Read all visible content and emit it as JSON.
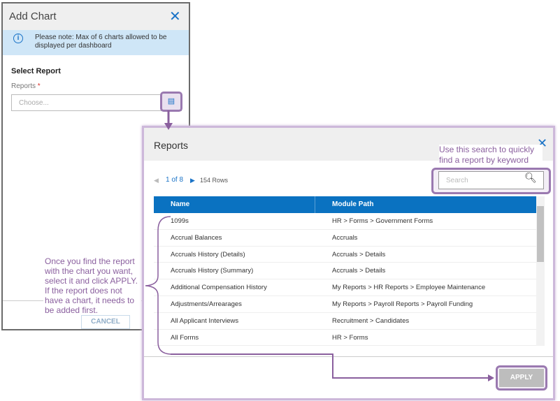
{
  "add_chart": {
    "title": "Add Chart",
    "banner": "Please note: Max of 6 charts allowed to be displayed per dashboard",
    "section": "Select Report",
    "reports_label": "Reports",
    "required": "*",
    "placeholder": "Choose...",
    "cancel": "CANCEL"
  },
  "callouts": {
    "search": "Use this search to quickly find a report by keyword",
    "select": "Once you find the report with the chart you want, select it and click APPLY. If the report does not have a chart, it needs to be added first."
  },
  "reports": {
    "title": "Reports",
    "page": "1 of 8",
    "rows": "154 Rows",
    "search_placeholder": "Search",
    "columns": [
      "Name",
      "Module Path"
    ],
    "items": [
      [
        "1099s",
        "HR > Forms > Government Forms"
      ],
      [
        "Accrual Balances",
        "Accruals"
      ],
      [
        "Accruals History (Details)",
        "Accruals > Details"
      ],
      [
        "Accruals History (Summary)",
        "Accruals > Details"
      ],
      [
        "Additional Compensation History",
        "My Reports > HR Reports > Employee Maintenance"
      ],
      [
        "Adjustments/Arrearages",
        "My Reports > Payroll Reports > Payroll Funding"
      ],
      [
        "All Applicant Interviews",
        "Recruitment > Candidates"
      ],
      [
        "All Forms",
        "HR > Forms"
      ]
    ],
    "apply": "APPLY"
  },
  "colors": {
    "accent": "#0a72c1",
    "callout": "#8a5f9e"
  }
}
